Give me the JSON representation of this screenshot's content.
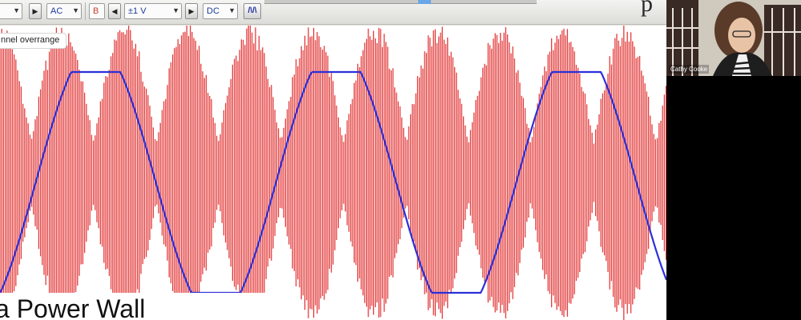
{
  "toolbar": {
    "coupling_value": "AC",
    "channel_label": "B",
    "range_value": "±1 V",
    "coupling_b_value": "DC",
    "waveform_icon_glyph": "/\\/\\"
  },
  "scope": {
    "overrange_label": "nnel overrange",
    "burst_color": "#e12a2a",
    "sine_color": "#2b2fd9",
    "background_color": "#ffffff"
  },
  "slide": {
    "title_text": "a Power Wall",
    "logo_fragment": "p"
  },
  "participant": {
    "name": "Cathy Cooke"
  },
  "icons": [
    "dropdown-caret-icon",
    "arrow-right-icon",
    "arrow-left-icon",
    "waveform-icon"
  ]
}
